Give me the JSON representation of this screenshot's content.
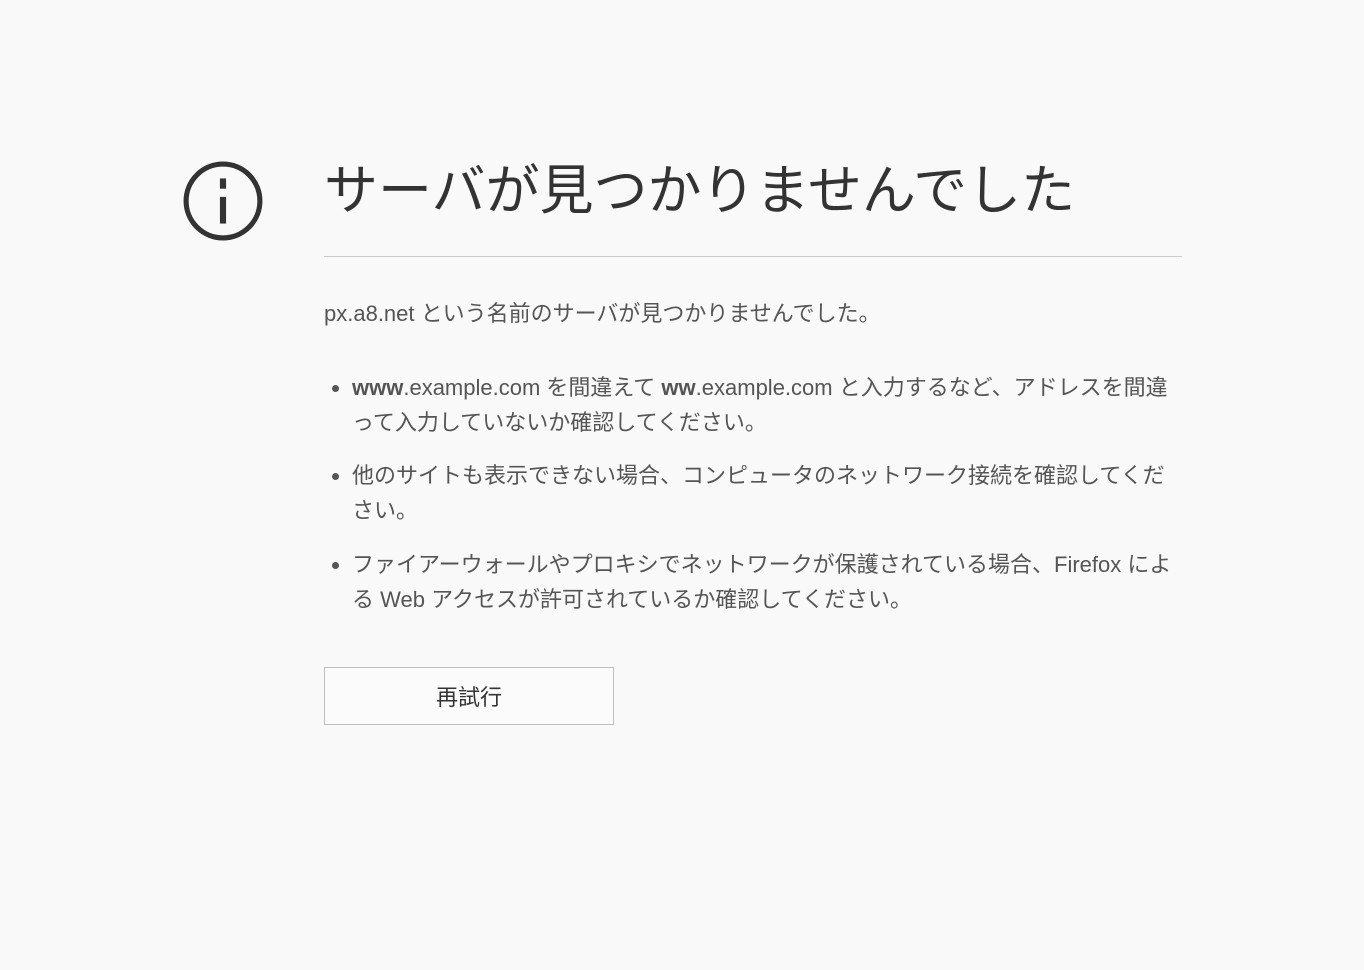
{
  "error": {
    "icon": "info-circle",
    "title": "サーバが見つかりませんでした",
    "description": "px.a8.net という名前のサーバが見つかりませんでした。",
    "tips": {
      "item1": {
        "bold1": "www",
        "text1": ".example.com を間違えて ",
        "bold2": "ww",
        "text2": ".example.com と入力するなど、アドレスを間違って入力していないか確認してください。"
      },
      "item2": "他のサイトも表示できない場合、コンピュータのネットワーク接続を確認してください。",
      "item3": "ファイアーウォールやプロキシでネットワークが保護されている場合、Firefox による Web アクセスが許可されているか確認してください。"
    },
    "retry_label": "再試行"
  }
}
